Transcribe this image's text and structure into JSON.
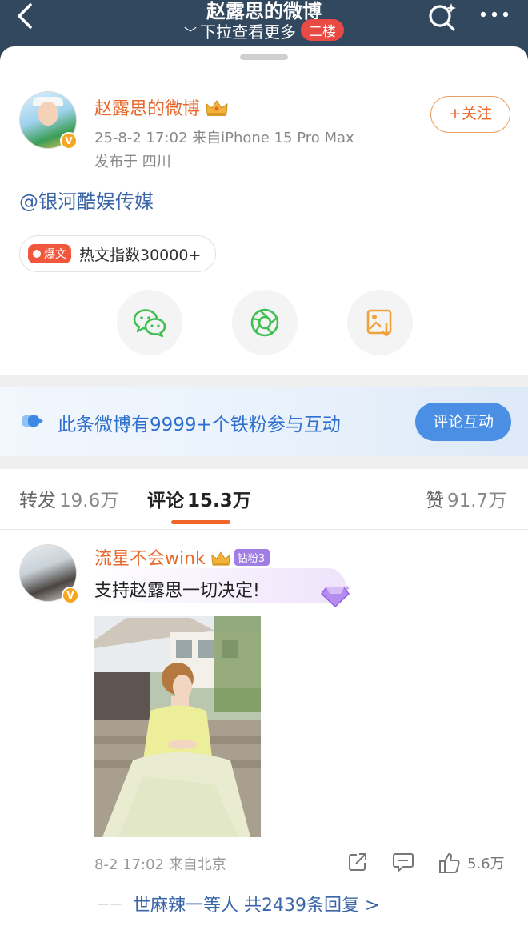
{
  "header": {
    "title": "赵露思的微博",
    "subtitle": "下拉查看更多",
    "floor_badge": "二楼"
  },
  "post": {
    "author": "赵露思的微博",
    "time_source": "25-8-2 17:02 来自iPhone 15 Pro Max",
    "location": "发布于 四川",
    "follow_label": "+关注",
    "text": "@银河酷娱传媒",
    "hot_tag": "爆文",
    "hot_text": "热文指数30000+"
  },
  "share": {
    "icons": [
      "wechat-icon",
      "moments-icon",
      "save-image-icon"
    ]
  },
  "fans_banner": {
    "text": "此条微博有9999+个铁粉参与互动",
    "button": "评论互动"
  },
  "tabs": {
    "repost_label": "转发",
    "repost_count": "19.6万",
    "comment_label": "评论",
    "comment_count": "15.3万",
    "like_label": "赞",
    "like_count": "91.7万"
  },
  "comment": {
    "author": "流星不会wink",
    "fan_badge": "钻粉3",
    "text": "支持赵露思一切决定!",
    "time_source": "8-2 17:02 来自北京",
    "like_count": "5.6万",
    "reply_summary": "世麻辣一等人 共2439条回复 >"
  },
  "colors": {
    "header_bg": "#32485e",
    "accent_orange": "#e8672a",
    "link_blue": "#3a66a8",
    "button_blue": "#4a8fe4",
    "floor_badge_red": "#e94b44"
  }
}
